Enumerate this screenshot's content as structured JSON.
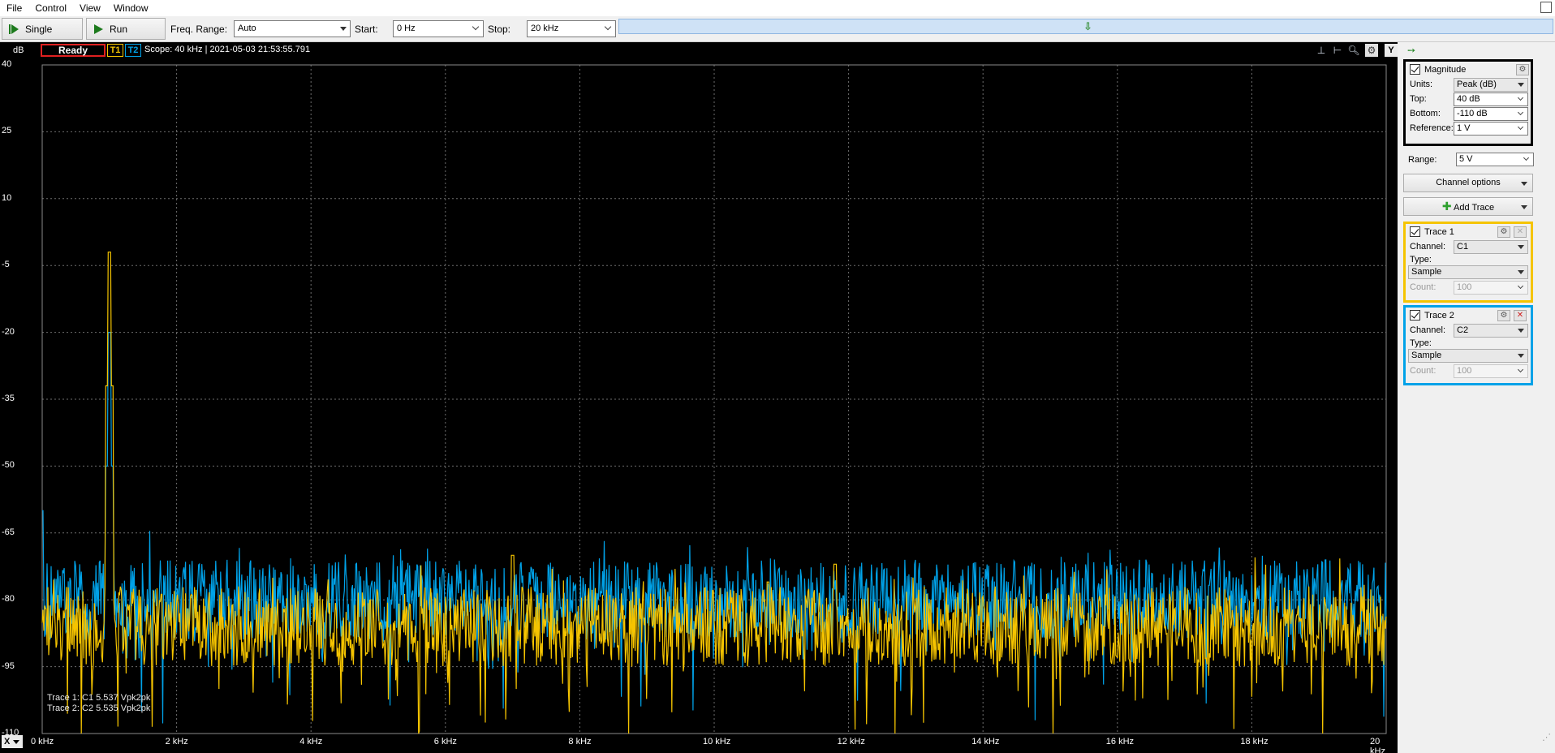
{
  "menu": [
    "File",
    "Control",
    "View",
    "Window"
  ],
  "toolbar": {
    "single_label": "Single",
    "run_label": "Run",
    "freq_range_label": "Freq. Range:",
    "freq_range_value": "Auto",
    "start_label": "Start:",
    "start_value": "0 Hz",
    "stop_label": "Stop:",
    "stop_value": "20 kHz"
  },
  "status": {
    "state": "Ready",
    "t1_badge": "T1",
    "t2_badge": "T2",
    "scope_info": "Scope: 40 kHz | 2021-05-03 21:53:55.791"
  },
  "plot": {
    "y_unit": "dB",
    "y_button": "Y",
    "x_button": "X",
    "legend": [
      "Trace 1: C1 5.537 Vpk2pk",
      "Trace 2: C2 5.535 Vpk2pk"
    ]
  },
  "colors": {
    "trace1": "#f5c400",
    "trace2": "#00a2e8",
    "background": "#000000",
    "grid": "#6e6e6e"
  },
  "chart_data": {
    "type": "line",
    "x_ticks": [
      "0 kHz",
      "2 kHz",
      "4 kHz",
      "6 kHz",
      "8 kHz",
      "10 kHz",
      "12 kHz",
      "14 kHz",
      "16 kHz",
      "18 kHz",
      "20 kHz"
    ],
    "y_ticks": [
      "40",
      "25",
      "10",
      "-5",
      "-20",
      "-35",
      "-50",
      "-65",
      "-80",
      "-95",
      "-110"
    ],
    "xlim": [
      0,
      20
    ],
    "ylim": [
      -110,
      40
    ],
    "grid": true,
    "series": [
      {
        "name": "Trace 1",
        "noise_floor_db": -86,
        "peaks": [
          {
            "freq_khz": 1.0,
            "db": -2
          },
          {
            "freq_khz": 7.0,
            "db": -70
          },
          {
            "freq_khz": 10.8,
            "db": -76
          },
          {
            "freq_khz": 11.8,
            "db": -72
          }
        ]
      },
      {
        "name": "Trace 2",
        "noise_floor_db": -80,
        "peaks": [
          {
            "freq_khz": 0.0,
            "db": -60
          },
          {
            "freq_khz": 1.0,
            "db": -20
          }
        ]
      }
    ]
  },
  "panel": {
    "magnitude": {
      "title": "Magnitude",
      "units_label": "Units:",
      "units_value": "Peak (dB)",
      "top_label": "Top:",
      "top_value": "40 dB",
      "bottom_label": "Bottom:",
      "bottom_value": "-110 dB",
      "reference_label": "Reference:",
      "reference_value": "1 V"
    },
    "range_label": "Range:",
    "range_value": "5 V",
    "channel_options_label": "Channel options",
    "add_trace_label": "Add Trace",
    "trace1": {
      "title": "Trace 1",
      "channel_label": "Channel:",
      "channel_value": "C1",
      "type_label": "Type:",
      "type_value": "Sample",
      "count_label": "Count:",
      "count_value": "100"
    },
    "trace2": {
      "title": "Trace 2",
      "channel_label": "Channel:",
      "channel_value": "C2",
      "type_label": "Type:",
      "type_value": "Sample",
      "count_label": "Count:",
      "count_value": "100"
    }
  }
}
